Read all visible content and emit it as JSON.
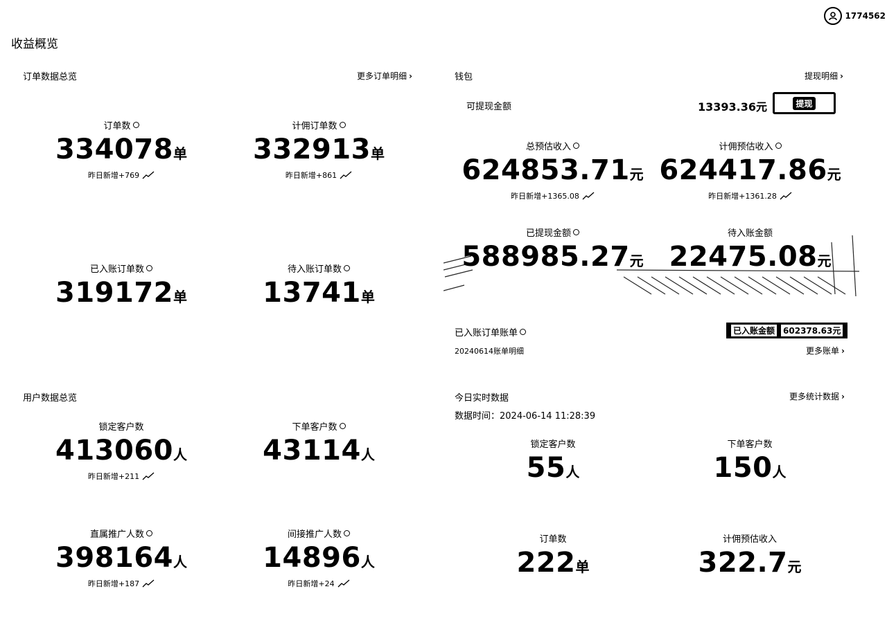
{
  "header": {
    "user_id": "1774562"
  },
  "page_title": "收益概览",
  "orders": {
    "title": "订单数据总览",
    "more_label": "更多订单明细",
    "metrics": [
      {
        "label": "订单数",
        "value": "334078",
        "unit": "单",
        "sub": "昨日新增+769"
      },
      {
        "label": "计佣订单数",
        "value": "332913",
        "unit": "单",
        "sub": "昨日新增+861"
      },
      {
        "label": "已入账订单数",
        "value": "319172",
        "unit": "单"
      },
      {
        "label": "待入账订单数",
        "value": "13741",
        "unit": "单"
      }
    ]
  },
  "wallet": {
    "title": "钱包",
    "more_label": "提现明细",
    "withdrawable_label": "可提现金额",
    "withdrawable_value": "13393.36元",
    "withdraw_button": "提现",
    "metrics": [
      {
        "label": "总预估收入",
        "value": "624853.71",
        "unit": "元",
        "sub": "昨日新增+1365.08"
      },
      {
        "label": "计佣预估收入",
        "value": "624417.86",
        "unit": "元",
        "sub": "昨日新增+1361.28"
      },
      {
        "label": "已提现金额",
        "value": "588985.27",
        "unit": "元"
      },
      {
        "label": "待入账金额",
        "value": "22475.08",
        "unit": "元"
      }
    ]
  },
  "bills": {
    "title": "已入账订单账单",
    "badge_label": "已入账金额",
    "badge_value": "602378.63元",
    "detail": "20240614账单明细",
    "more_label": "更多账单"
  },
  "users": {
    "title": "用户数据总览",
    "metrics": [
      {
        "label": "锁定客户数",
        "value": "413060",
        "unit": "人",
        "sub": "昨日新增+211"
      },
      {
        "label": "下单客户数",
        "value": "43114",
        "unit": "人"
      },
      {
        "label": "直属推广人数",
        "value": "398164",
        "unit": "人",
        "sub": "昨日新增+187"
      },
      {
        "label": "间接推广人数",
        "value": "14896",
        "unit": "人",
        "sub": "昨日新增+24"
      }
    ]
  },
  "realtime": {
    "title": "今日实时数据",
    "more_label": "更多统计数据",
    "time_label": "数据时间：",
    "time_value": "2024-06-14 11:28:39",
    "metrics": [
      {
        "label": "锁定客户数",
        "value": "55",
        "unit": "人"
      },
      {
        "label": "下单客户数",
        "value": "150",
        "unit": "人"
      },
      {
        "label": "订单数",
        "value": "222",
        "unit": "单"
      },
      {
        "label": "计佣预估收入",
        "value": "322.7",
        "unit": "元"
      }
    ]
  }
}
